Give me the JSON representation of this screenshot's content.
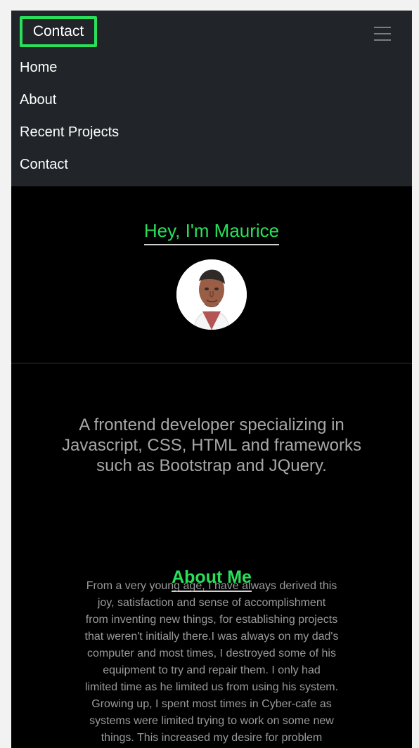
{
  "navbar": {
    "brand": "Contact",
    "toggle_icon": "hamburger-menu-icon",
    "items": [
      {
        "label": "Home"
      },
      {
        "label": "About"
      },
      {
        "label": "Recent Projects"
      },
      {
        "label": "Contact"
      }
    ]
  },
  "hero": {
    "title": "Hey, I'm Maurice",
    "avatar_icon": "portrait-avatar-icon"
  },
  "tagline": "A frontend developer specializing in Javascript, CSS, HTML and frameworks such as Bootstrap and JQuery.",
  "about": {
    "title": "About Me",
    "text": "From a very young age, I have always derived this\njoy, satisfaction and sense of accomplishment\nfrom inventing new things, for establishing projects\nthat weren't initially there.I was always on my dad's\ncomputer and most times, I destroyed some of his\nequipment to try and repair them. I only had\nlimited time as he limited us from using his system.\nGrowing up, I spent most times in Cyber-cafe as\nsystems were limited trying to work on some new\nthings. This increased my desire for problem"
  },
  "colors": {
    "accent": "#28e05a",
    "navbar_bg": "#212529",
    "page_bg": "#000000",
    "muted_text": "#a7a7a7"
  }
}
